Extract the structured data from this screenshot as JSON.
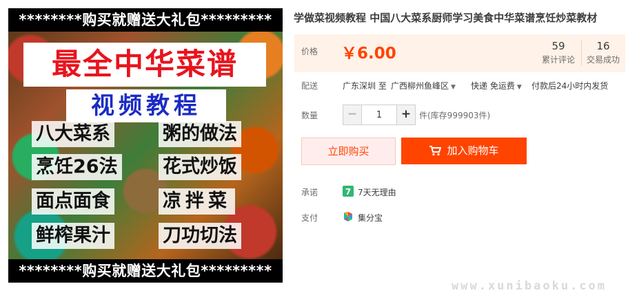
{
  "product": {
    "title": "学做菜视频教程 中国八大菜系厨师学习美食中华菜谱烹饪炒菜教材",
    "image": {
      "banner_top": "********购买就赠送大礼包*********",
      "main_title": "最全中华菜谱",
      "subtitle": "视频教程",
      "topics": [
        "八大菜系",
        "粥的做法",
        "烹饪26法",
        "花式炒饭",
        "面点面食",
        "凉拌菜",
        "鲜榨果汁",
        "刀功切法"
      ],
      "banner_bottom": "********购买就赠送大礼包*********"
    }
  },
  "price": {
    "label": "价格",
    "value": "￥6.00"
  },
  "stats": {
    "reviews": {
      "count": "59",
      "label": "累计评论"
    },
    "sales": {
      "count": "16",
      "label": "交易成功"
    }
  },
  "shipping": {
    "label": "配送",
    "from": "广东深圳 至",
    "to": "广西柳州鱼峰区",
    "method": "快递 免运费",
    "promise": "付款后24小时内发货"
  },
  "quantity": {
    "label": "数量",
    "value": "1",
    "minus": "−",
    "plus": "+",
    "stock": "件(库存999903件)"
  },
  "actions": {
    "buy_now": "立即购买",
    "add_to_cart": "加入购物车"
  },
  "promise": {
    "label": "承诺",
    "text": "7天无理由",
    "icon": "seven-day-icon",
    "icon_color": "#2eb872"
  },
  "payment": {
    "label": "支付",
    "text": "集分宝",
    "icon": "jifenbao-icon"
  },
  "watermark": "www.xunibaoku.com",
  "colors": {
    "accent": "#ff4400",
    "price_bg": "#fff2e8"
  }
}
